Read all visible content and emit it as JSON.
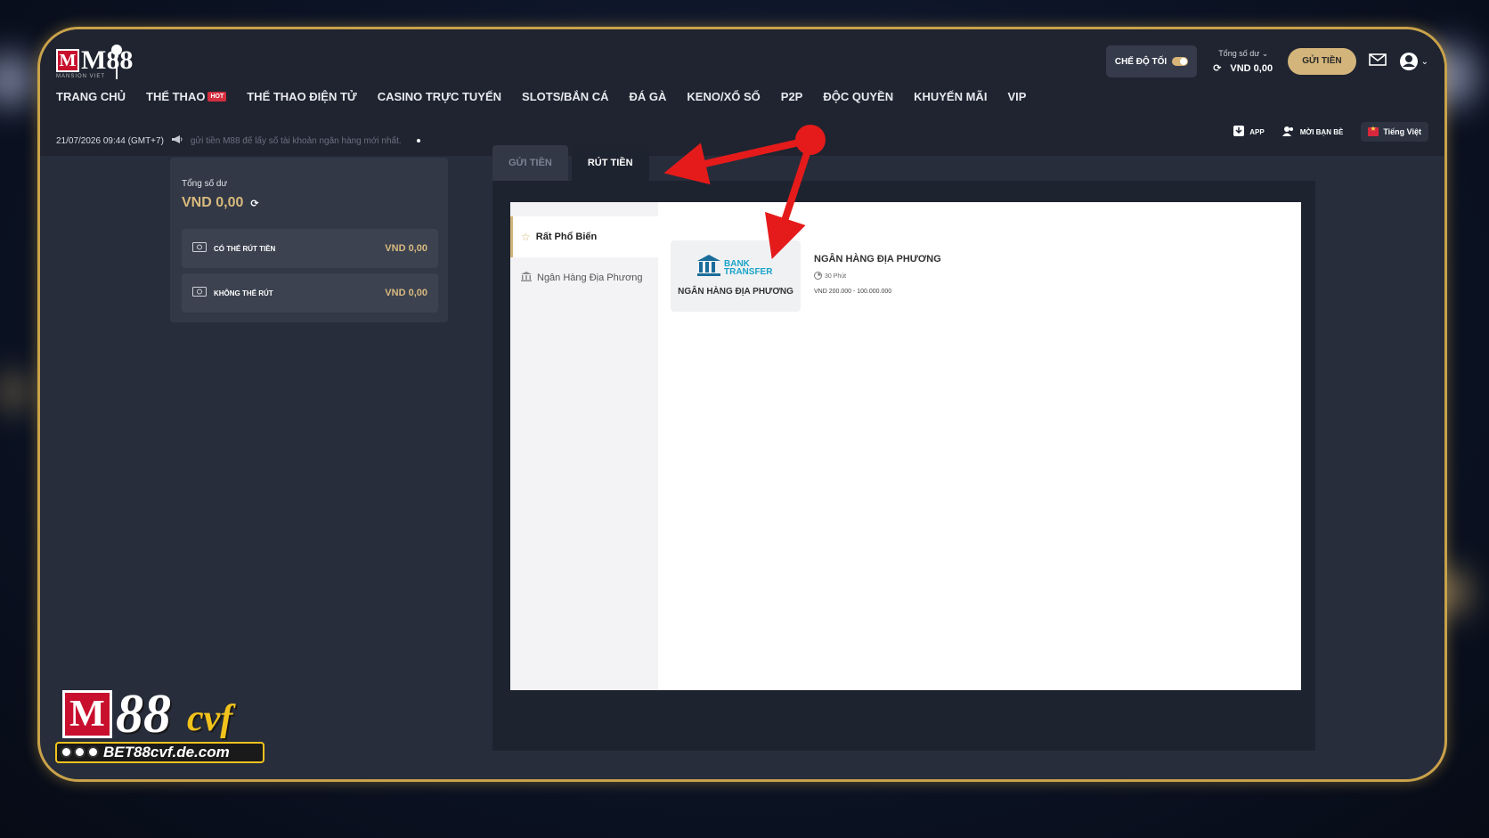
{
  "header": {
    "logo_text": "M88",
    "logo_sub": "MANSION VIET",
    "nav": [
      {
        "label": "TRANG CHỦ"
      },
      {
        "label": "THỂ THAO",
        "badge": "HOT"
      },
      {
        "label": "THỂ THAO ĐIỆN TỬ"
      },
      {
        "label": "CASINO TRỰC TUYẾN"
      },
      {
        "label": "SLOTS/BẮN CÁ"
      },
      {
        "label": "ĐÁ GÀ"
      },
      {
        "label": "KENO/XỔ SỐ"
      },
      {
        "label": "P2P"
      },
      {
        "label": "ĐỘC QUYỀN"
      },
      {
        "label": "KHUYẾN MÃI"
      },
      {
        "label": "VIP"
      }
    ],
    "dark_mode_label": "CHẾ ĐỘ TỐI",
    "balance_label": "Tổng số dư",
    "balance_value": "VND 0,00",
    "deposit_button": "GỬI TIỀN",
    "datetime": "21/07/2026 09:44 (GMT+7)",
    "ticker_text": "gửi tiền M88 để lấy số tài khoản ngân hàng mới nhất.",
    "utility": {
      "app": "APP",
      "invite": "MỜI BẠN BÈ",
      "language": "Tiếng Việt"
    }
  },
  "wallet": {
    "title": "Tổng số dư",
    "total": "VND 0,00",
    "rows": [
      {
        "label": "CÓ THỂ RÚT TIỀN",
        "amount": "VND 0,00"
      },
      {
        "label": "KHÔNG THỂ RÚT",
        "amount": "VND 0,00"
      }
    ]
  },
  "tabs": {
    "deposit": "GỬI TIỀN",
    "withdraw": "RÚT TIỀN",
    "active": "withdraw"
  },
  "categories": [
    {
      "label": "Rất Phổ Biến",
      "icon": "star-icon",
      "selected": true
    },
    {
      "label": "Ngân Hàng Địa Phương",
      "icon": "bank-icon",
      "selected": false
    }
  ],
  "method": {
    "logo_line1": "BANK",
    "logo_line2": "TRANSFER",
    "name": "NGÂN HÀNG ĐỊA PHƯƠNG",
    "title": "NGÂN HÀNG ĐỊA PHƯƠNG",
    "time": "30 Phút",
    "range": "VND 200.000 - 100.000.000"
  },
  "watermark": {
    "brand_m": "M",
    "brand_num": "88",
    "brand_suffix": "cvf",
    "url": "BET88cvf.de.com"
  },
  "colors": {
    "accent_gold": "#d3b47a",
    "frame_gold": "#c9a24a",
    "arrow_red": "#e51b1b",
    "bank_blue": "#1aa3c8"
  }
}
